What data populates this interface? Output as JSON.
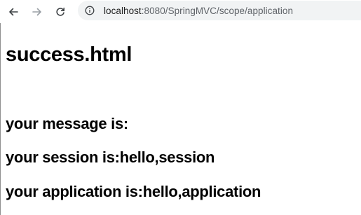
{
  "browser": {
    "url_host": "localhost",
    "url_rest": ":8080/SpringMVC/scope/application"
  },
  "page": {
    "heading": "success.html",
    "lines": [
      "your message is:",
      "your session is:hello,session",
      "your application is:hello,application"
    ]
  }
}
